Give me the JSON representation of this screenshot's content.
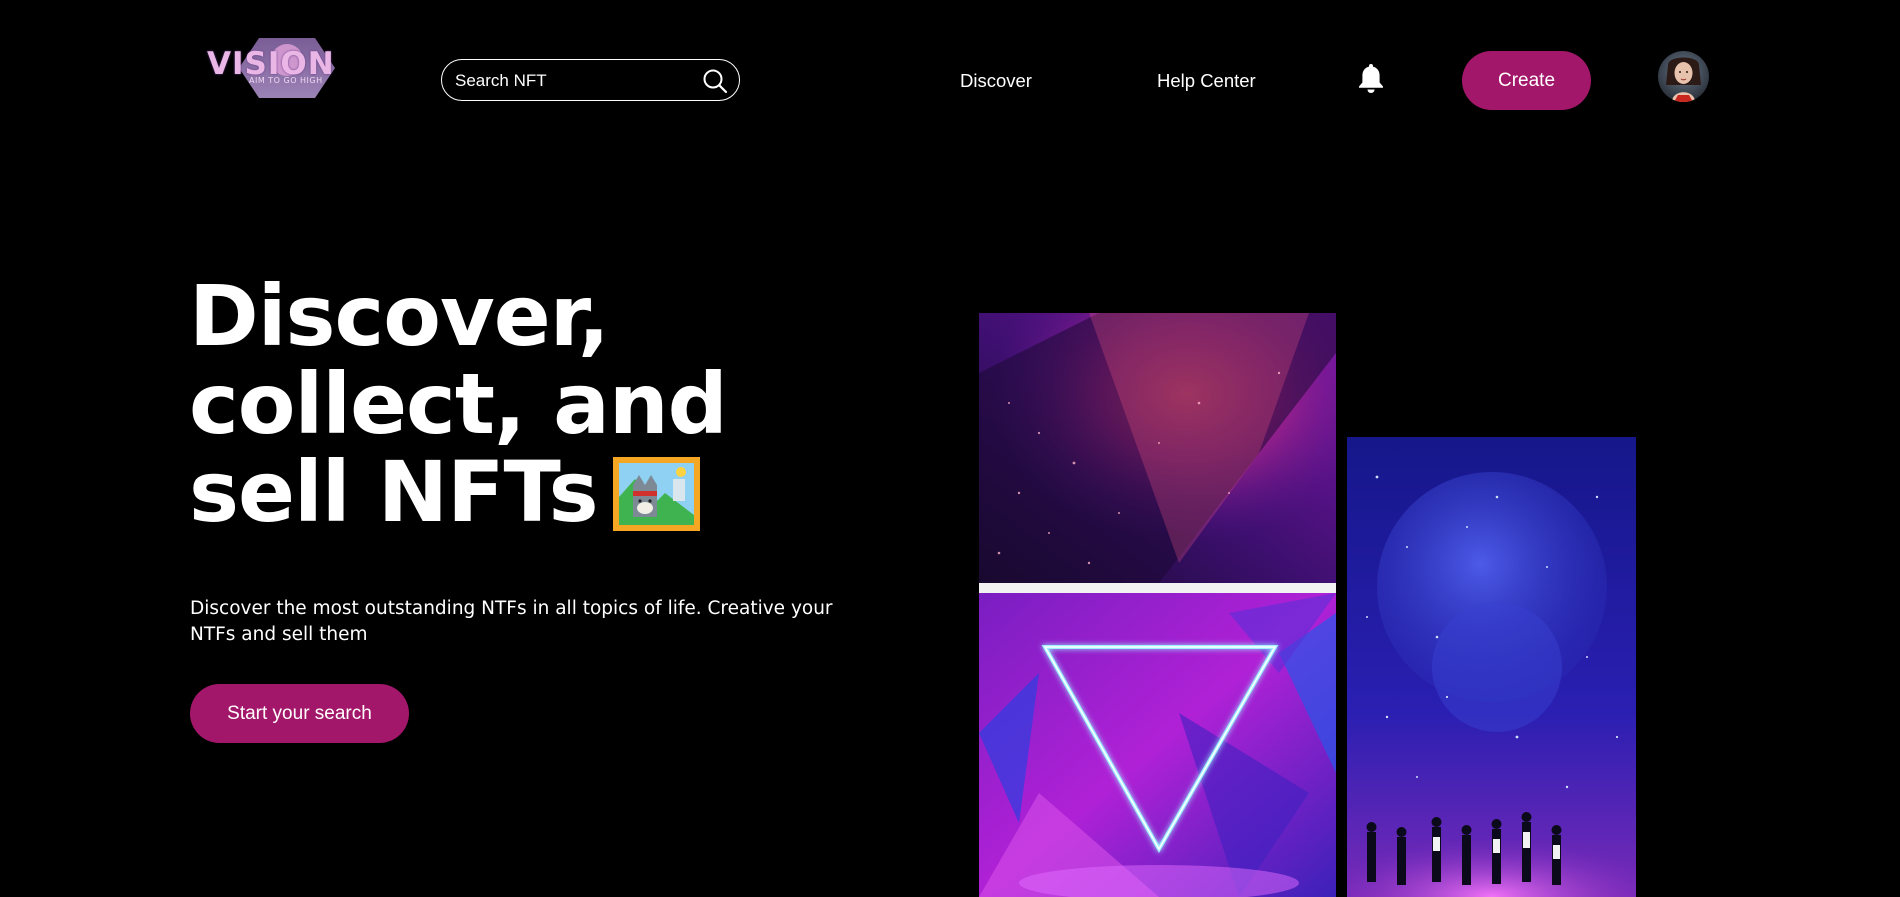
{
  "header": {
    "logo": {
      "name": "VISION",
      "tagline": "AIM TO GO HIGH"
    },
    "search": {
      "placeholder": "Search NFT"
    },
    "nav": [
      {
        "label": "Discover"
      },
      {
        "label": "Help Center"
      }
    ],
    "create_label": "Create",
    "icons": {
      "search": "search-icon",
      "notifications": "bell-icon",
      "profile": "avatar"
    }
  },
  "hero": {
    "title_lines": [
      "Discover,",
      "collect, and",
      "sell NFTs"
    ],
    "title_emoji": "framed-picture-emoji",
    "description": "Discover the most outstanding NTFs in all topics of life. Creative your NTFs and sell them",
    "cta_label": "Start your search"
  },
  "gallery": [
    {
      "name": "nft-art-nebula"
    },
    {
      "name": "nft-art-neon-triangle"
    },
    {
      "name": "nft-art-galaxy-crowd"
    }
  ],
  "colors": {
    "background": "#000000",
    "accent": "#a3176b",
    "text": "#ffffff"
  }
}
